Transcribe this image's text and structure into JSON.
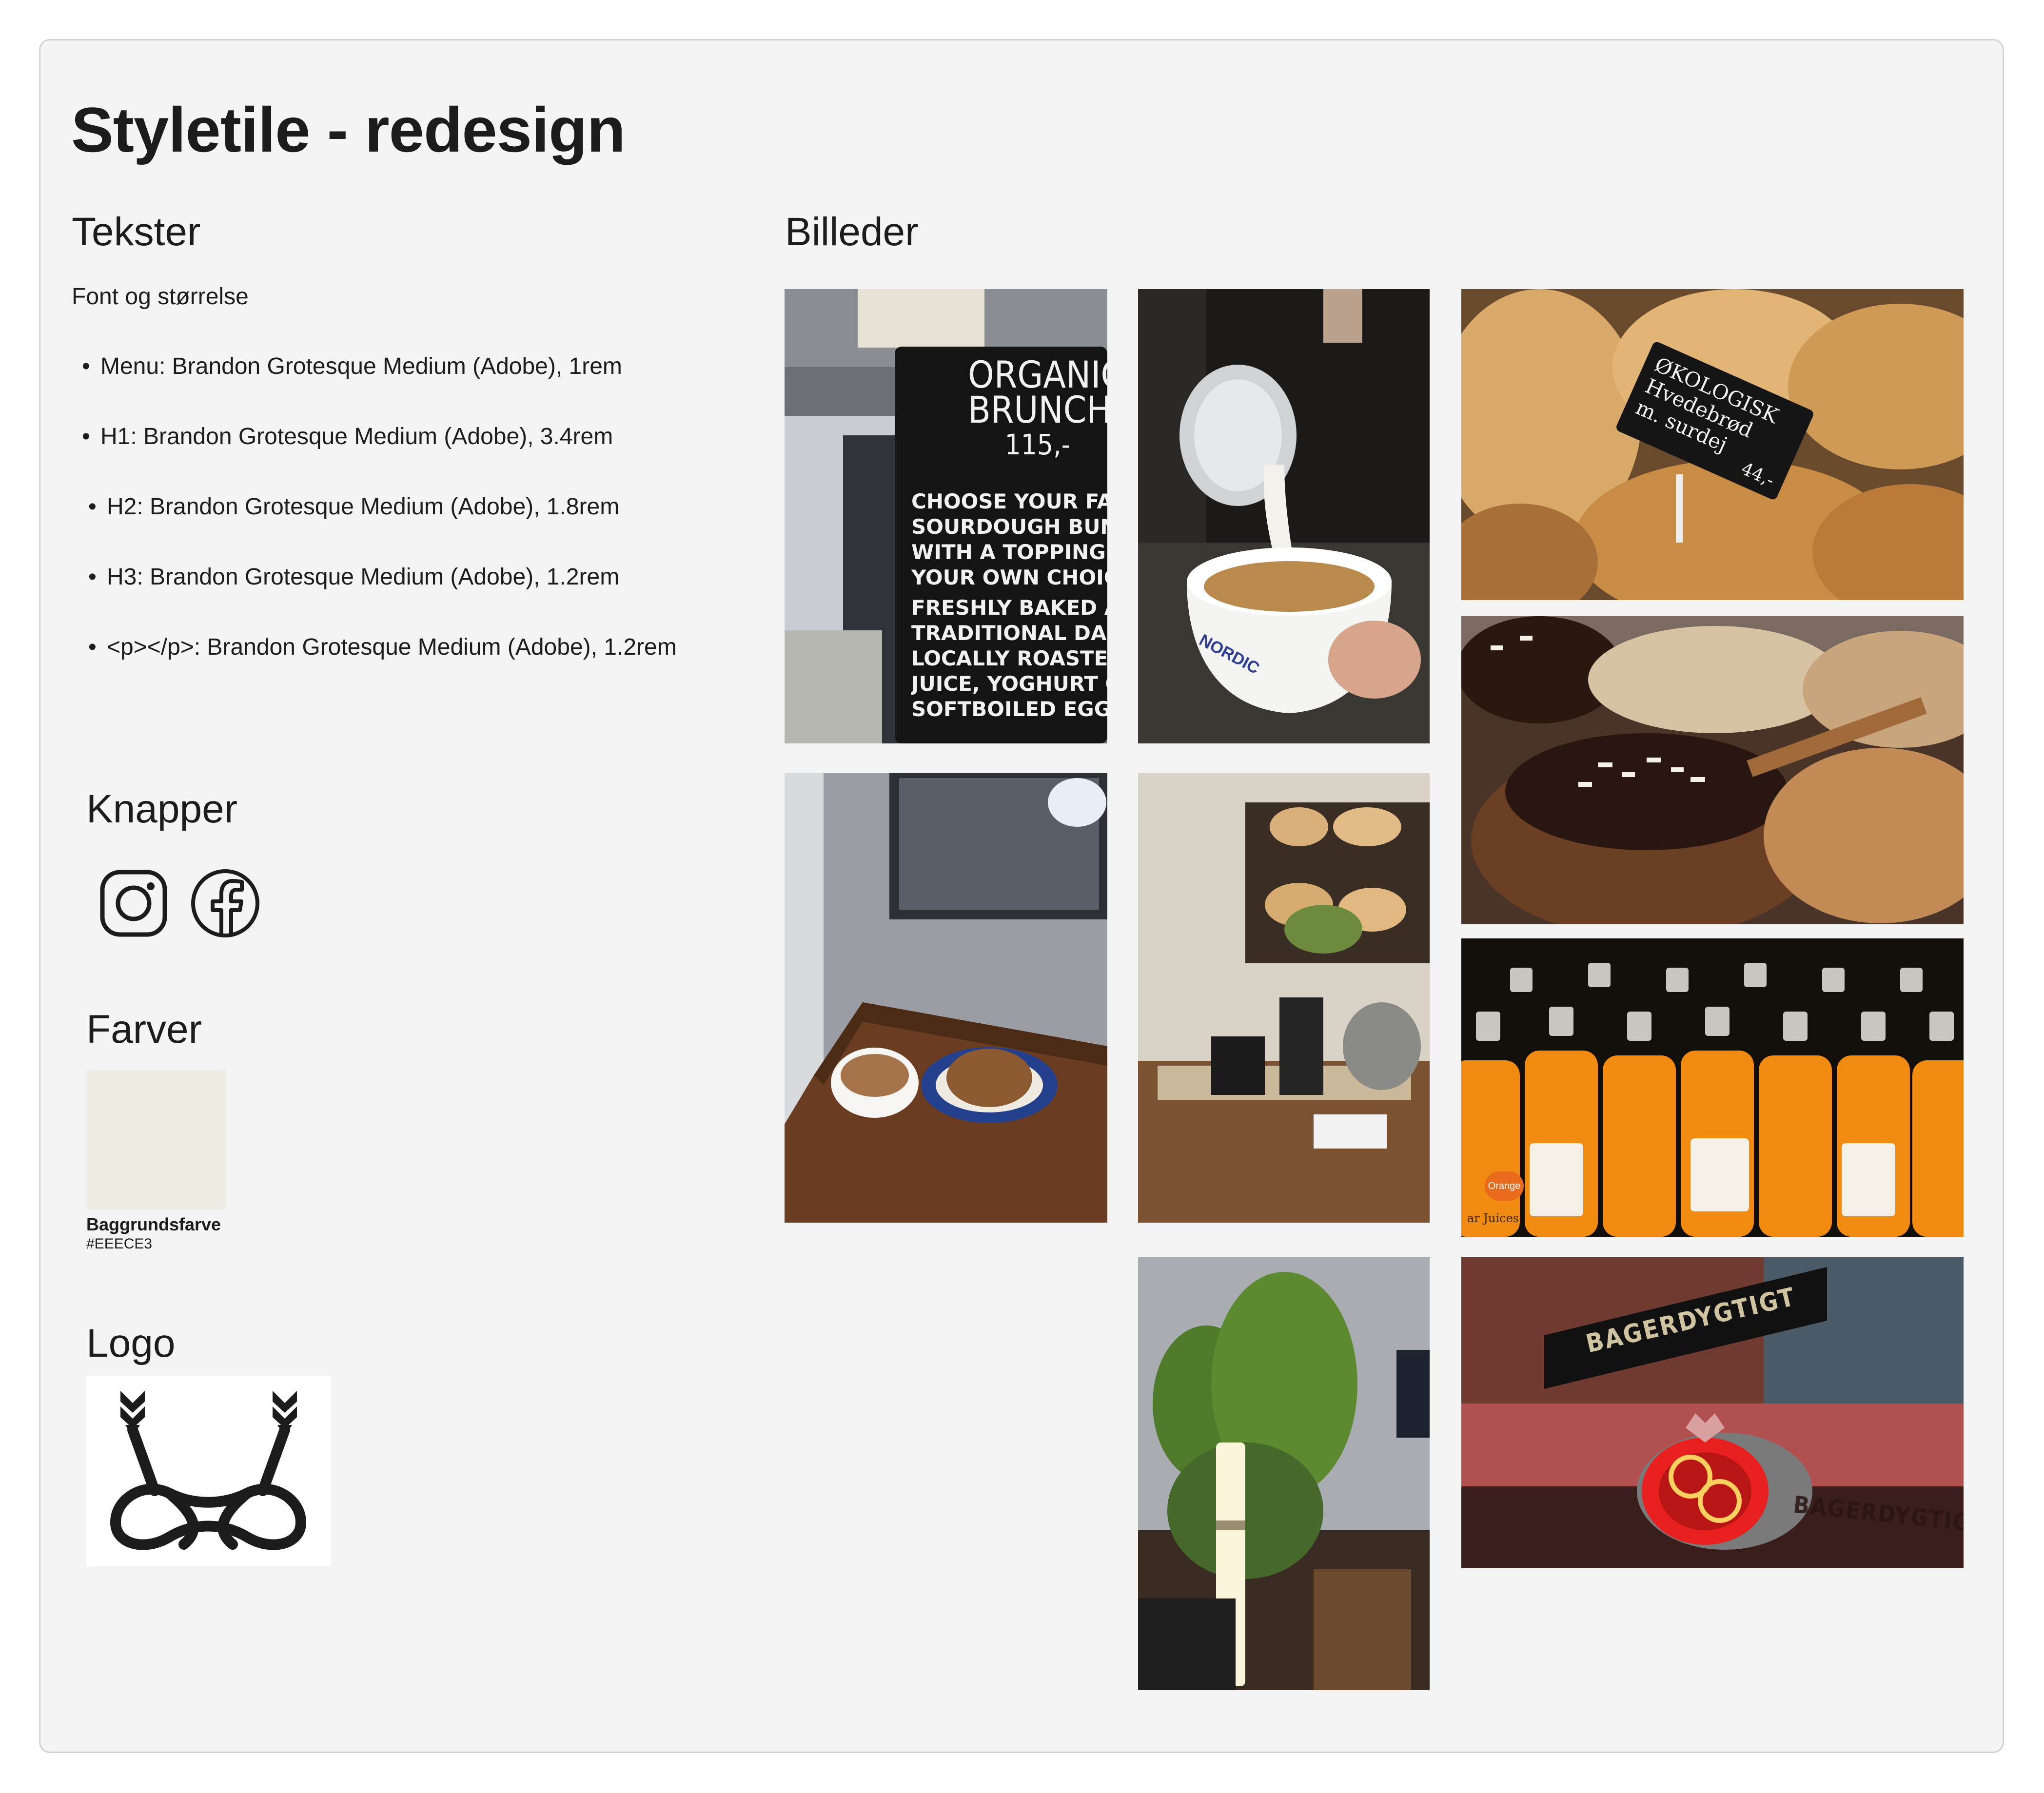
{
  "page": {
    "title": "Styletile - redesign"
  },
  "texts": {
    "heading": "Tekster",
    "subheading": "Font og størrelse",
    "items": [
      "Menu: Brandon Grotesque Medium (Adobe), 1rem",
      "H1: Brandon Grotesque Medium (Adobe), 3.4rem",
      "H2: Brandon Grotesque Medium (Adobe), 1.8rem",
      "H3: Brandon Grotesque Medium (Adobe), 1.2rem",
      "<p></p>: Brandon Grotesque Medium (Adobe), 1.2rem"
    ]
  },
  "buttons": {
    "heading": "Knapper",
    "icons": [
      "instagram-icon",
      "facebook-icon"
    ]
  },
  "colors": {
    "heading": "Farver",
    "swatches": [
      {
        "label": "Baggrundsfarve",
        "hex": "#EEECE3"
      }
    ]
  },
  "logo": {
    "heading": "Logo",
    "icon": "arrows-knot-logo"
  },
  "images": {
    "heading": "Billeder",
    "chalkboard": {
      "title_line1": "ORGANIC",
      "title_line2": "BRUNCH",
      "price": "115,-",
      "lines": [
        "CHOOSE YOUR FAVO",
        "SOURDOUGH BUN",
        "WITH A TOPPING O",
        "YOUR OWN CHOICE",
        "FRESHLY BAKED AN",
        "TRADITIONAL DANIS",
        "LOCALLY ROASTED COFFE",
        "JUICE, YOGHURT OR",
        "SOFTBOILED EGG"
      ]
    },
    "bread_tag": {
      "line1": "ØKOLOGISK",
      "line2": "Hvedebrød",
      "line3": "m. surdej",
      "price": "44,-"
    },
    "cup_text": "NORDIC",
    "juice_label": "Orange",
    "juice_side_text": "ar Juices",
    "shop_sign": "BAGERDYGTIGT",
    "shop_window": "BAGERDYGTIGT"
  }
}
